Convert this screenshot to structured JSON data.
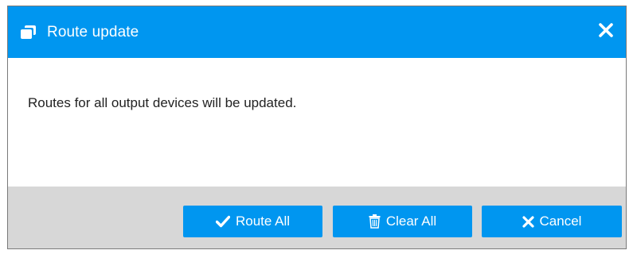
{
  "dialog": {
    "title": "Route update",
    "title_icon": "copy-icon",
    "close_icon": "close-icon",
    "message": "Routes for all output devices will be updated."
  },
  "buttons": {
    "route_all": {
      "label": "Route All",
      "icon": "checkmark-icon"
    },
    "clear_all": {
      "label": "Clear All",
      "icon": "trash-icon"
    },
    "cancel": {
      "label": "Cancel",
      "icon": "x-icon"
    }
  },
  "colors": {
    "accent": "#0096f0",
    "footer_bg": "#d7d7d7",
    "text": "#222222"
  }
}
